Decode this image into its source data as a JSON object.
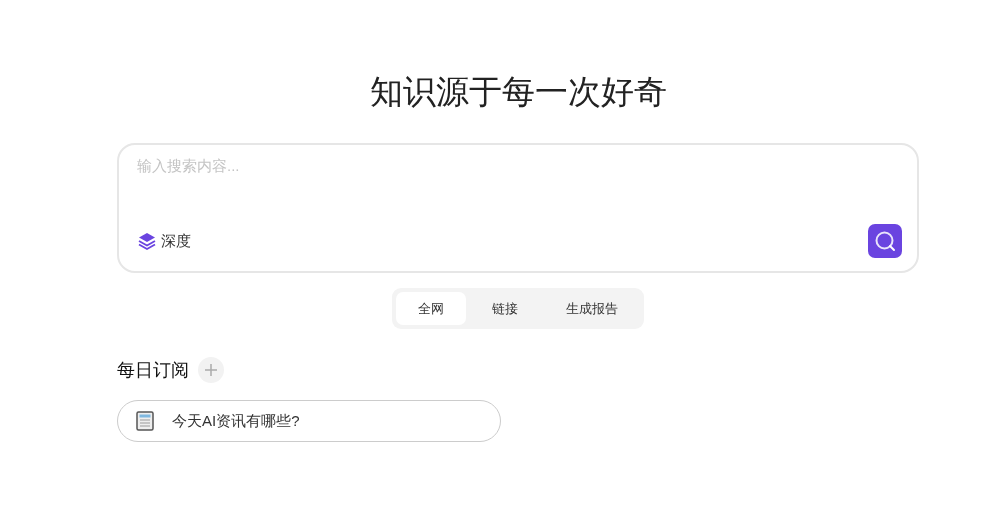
{
  "heading": "知识源于每一次好奇",
  "search": {
    "placeholder": "输入搜索内容...",
    "mode_label": "深度"
  },
  "tabs": [
    {
      "label": "全网",
      "selected": true
    },
    {
      "label": "链接",
      "selected": false
    },
    {
      "label": "生成报告",
      "selected": false
    }
  ],
  "subscriptions": {
    "title": "每日订阅",
    "items": [
      {
        "label": "今天AI资讯有哪些?"
      }
    ]
  }
}
